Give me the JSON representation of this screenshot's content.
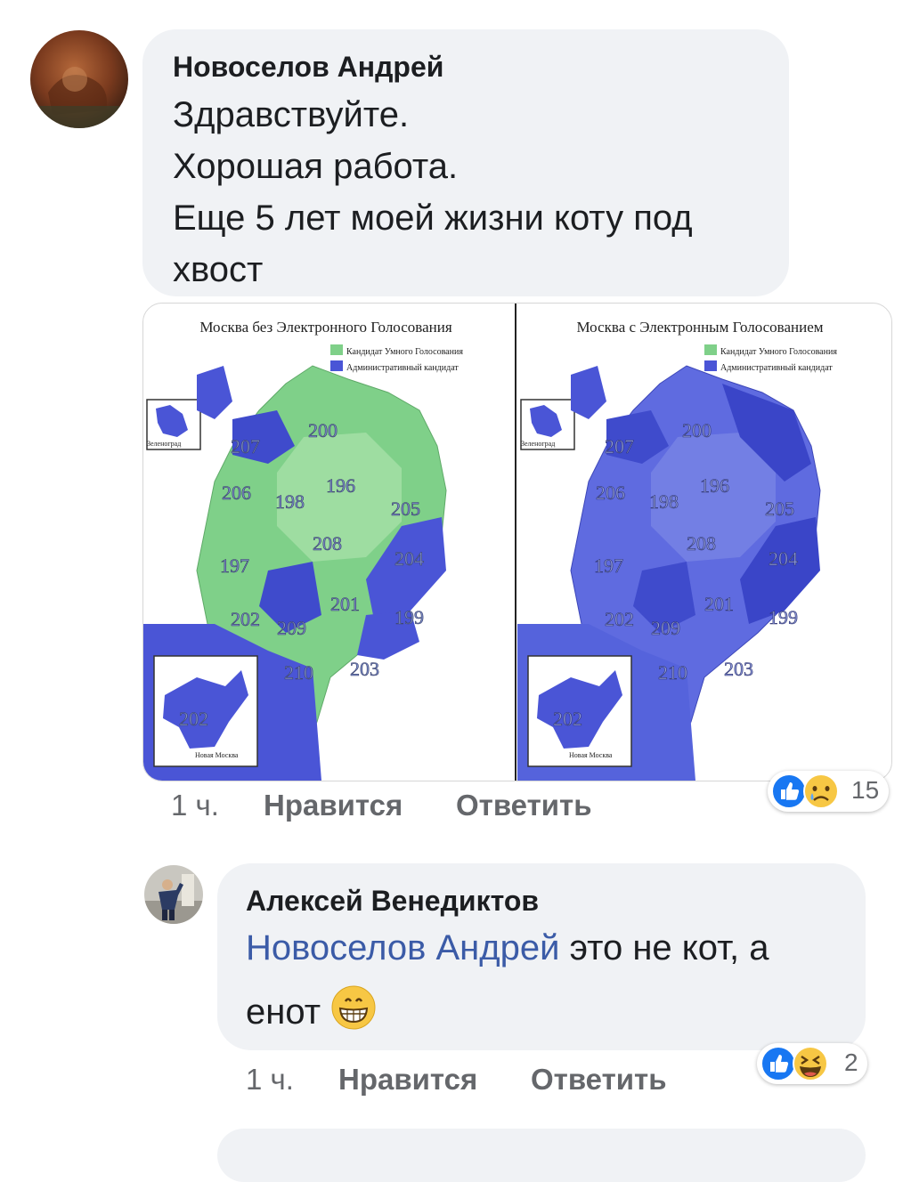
{
  "comments": [
    {
      "author": "Новоселов Андрей",
      "lines": [
        "Здравствуйте.",
        "Хорошая работа.",
        "Еще 5 лет моей жизни коту под",
        "хвост"
      ],
      "time": "1 ч.",
      "like_label": "Нравится",
      "reply_label": "Ответить",
      "reaction_count": "15",
      "reaction_icons": [
        "like-icon",
        "sad-icon"
      ]
    },
    {
      "author": "Алексей Венедиктов",
      "mention": "Новоселов Андрей",
      "text_part1": " это не кот, а",
      "text_part2": "енот ",
      "emoji_icon": "grinning-face-icon",
      "time": "1 ч.",
      "like_label": "Нравится",
      "reply_label": "Ответить",
      "reaction_count": "2",
      "reaction_icons": [
        "like-icon",
        "laughing-icon"
      ]
    }
  ],
  "attachment": {
    "left_map": {
      "title": "Москва без Электронного Голосования",
      "legend": [
        "Кандидат Умного Голосования",
        "Административный кандидат"
      ],
      "zelenograd_label": "Зеленоград",
      "new_moscow_label": "Новая Москва",
      "districts": [
        "200",
        "207",
        "206",
        "198",
        "196",
        "205",
        "208",
        "204",
        "197",
        "201",
        "199",
        "202",
        "209",
        "210",
        "203",
        "202"
      ]
    },
    "right_map": {
      "title": "Москва с Электронным Голосованием",
      "legend": [
        "Кандидат Умного Голосования",
        "Административный кандидат"
      ],
      "zelenograd_label": "Зеленоград",
      "new_moscow_label": "Новая Москва",
      "districts": [
        "200",
        "207",
        "206",
        "198",
        "196",
        "205",
        "208",
        "204",
        "197",
        "201",
        "199",
        "202",
        "209",
        "210",
        "203",
        "202"
      ]
    }
  },
  "colors": {
    "smart_vote_green": "#7fd089",
    "admin_blue": "#4a55d6",
    "link_blue": "#3b5ba7",
    "like_blue": "#1877f2"
  }
}
